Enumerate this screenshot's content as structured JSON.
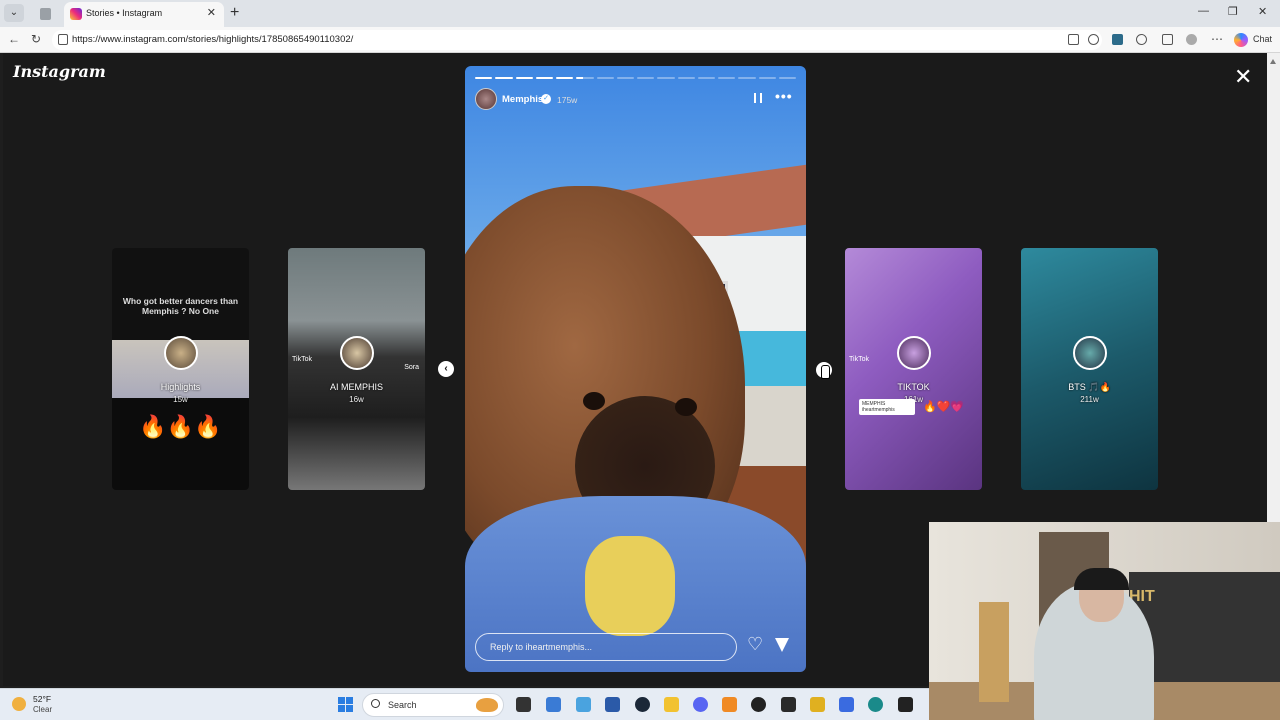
{
  "browser": {
    "tab_title": "Stories • Instagram",
    "url": "https://www.instagram.com/stories/highlights/17850865490110302/",
    "chat_label": "Chat",
    "tab_close_glyph": "✕",
    "new_tab_glyph": "+",
    "tab_list_glyph": "⌄",
    "back_glyph": "←",
    "reload_glyph": "↻",
    "more_glyph": "⋯",
    "minimize_glyph": "—",
    "restore_glyph": "❐",
    "close_glyph": "✕"
  },
  "instagram": {
    "logo_text": "Instagram",
    "close_glyph": "✕",
    "prev_glyph": "‹",
    "next_glyph": "›",
    "story": {
      "username": "Memphis",
      "verified_glyph": "✓",
      "age": "175w",
      "more_glyph": "•••",
      "reply_placeholder": "Reply to iheartmemphis...",
      "heart_glyph": "♡",
      "segments_total": 16,
      "segments_done": 5
    },
    "highlights": [
      {
        "name": "Highlights",
        "age": "15w",
        "caption": "Who got better dancers than Memphis ? No One",
        "extra": "🔥🔥🔥"
      },
      {
        "name": "AI MEMPHIS",
        "age": "16w",
        "tiktok": "TikTok",
        "sora": "Sora"
      },
      {
        "name": "TIKTOK",
        "age": "161w",
        "tiktok": "TikTok",
        "tag": "MEMPHIS iheartmemphis",
        "hearts": "🔥❤️💗"
      },
      {
        "name": "BTS 🎵🔥",
        "age": "211w"
      }
    ]
  },
  "webcam": {
    "bed_text": "HIT"
  },
  "taskbar": {
    "temperature": "52°F",
    "condition": "Clear",
    "search_placeholder": "Search"
  },
  "colors": {
    "page_bg": "#1a1a1a",
    "accent_blue": "#3897f0",
    "taskbar_bg": "#e6ecf4"
  }
}
